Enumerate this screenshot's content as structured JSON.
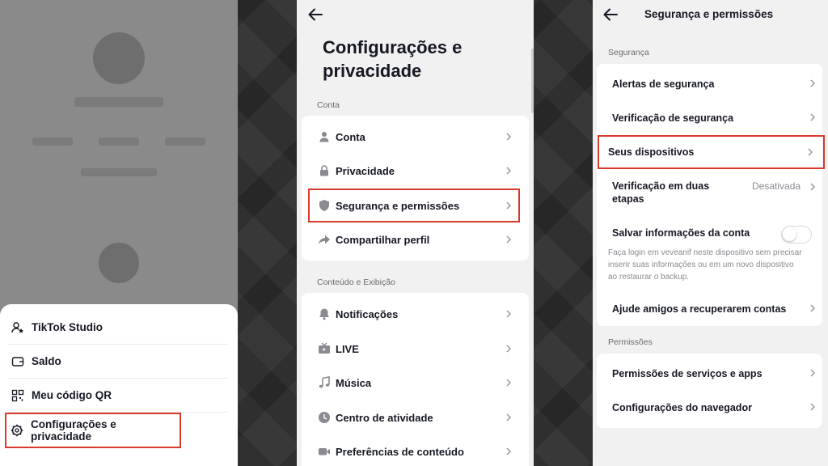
{
  "bottom_sheet": {
    "items": [
      {
        "label": "TikTok Studio",
        "icon": "person-star-icon"
      },
      {
        "label": "Saldo",
        "icon": "wallet-icon"
      },
      {
        "label": "Meu código QR",
        "icon": "qr-code-icon"
      },
      {
        "label": "Configurações e privacidade",
        "icon": "gear-icon"
      }
    ]
  },
  "settings": {
    "title": "Configurações e privacidade",
    "section_account": "Conta",
    "account_items": [
      {
        "label": "Conta",
        "icon": "person-icon"
      },
      {
        "label": "Privacidade",
        "icon": "lock-icon"
      },
      {
        "label": "Segurança e permissões",
        "icon": "shield-icon"
      },
      {
        "label": "Compartilhar perfil",
        "icon": "share-icon"
      }
    ],
    "section_content": "Conteúdo e Exibição",
    "content_items": [
      {
        "label": "Notificações",
        "icon": "bell-icon"
      },
      {
        "label": "LIVE",
        "icon": "tv-icon"
      },
      {
        "label": "Música",
        "icon": "music-note-icon"
      },
      {
        "label": "Centro de atividade",
        "icon": "clock-icon"
      },
      {
        "label": "Preferências de conteúdo",
        "icon": "video-camera-icon"
      }
    ]
  },
  "security": {
    "title": "Segurança e permissões",
    "section_security": "Segurança",
    "security_items": [
      {
        "label": "Alertas de segurança"
      },
      {
        "label": "Verificação de segurança"
      },
      {
        "label": "Seus dispositivos"
      },
      {
        "label": "Verificação em duas etapas",
        "status": "Desativada"
      },
      {
        "label": "Salvar informações da conta"
      },
      {
        "label": "Ajude amigos a recuperarem contas"
      }
    ],
    "save_info_description": "Faça login em veveanif neste dispositivo sem precisar inserir suas informações ou em um novo dispositivo ao restaurar o backup.",
    "save_info_toggle_on": false,
    "section_permissions": "Permissões",
    "permission_items": [
      {
        "label": "Permissões de serviços e apps"
      },
      {
        "label": "Configurações do navegador"
      }
    ]
  },
  "colors": {
    "highlight": "#d93a2b",
    "muted_text": "#8a8b91"
  }
}
